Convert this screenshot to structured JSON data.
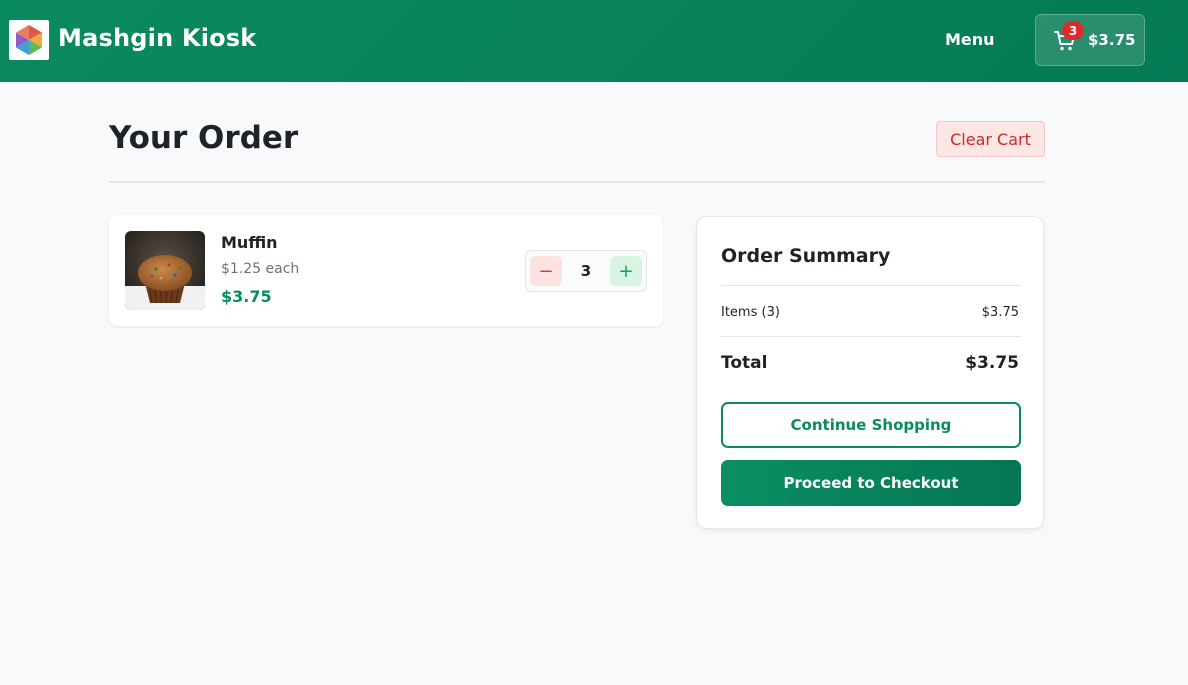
{
  "header": {
    "brand_title": "Mashgin Kiosk",
    "logo_icon": "cube-logo-icon",
    "nav_menu_label": "Menu",
    "cart": {
      "icon": "cart-icon",
      "badge_count": "3",
      "total": "$3.75"
    }
  },
  "page": {
    "title": "Your Order",
    "clear_cart_label": "Clear Cart"
  },
  "cart_items": [
    {
      "name": "Muffin",
      "unit_price": "$1.25 each",
      "subtotal": "$3.75",
      "quantity": "3",
      "minus_symbol": "−",
      "plus_symbol": "+"
    }
  ],
  "summary": {
    "title": "Order Summary",
    "items_label": "Items (3)",
    "items_value": "$3.75",
    "total_label": "Total",
    "total_value": "$3.75",
    "continue_label": "Continue Shopping",
    "checkout_label": "Proceed to Checkout"
  },
  "colors": {
    "brand_green": "#0a8a5f",
    "danger_red": "#d42727",
    "badge_red": "#dc2b2b"
  }
}
